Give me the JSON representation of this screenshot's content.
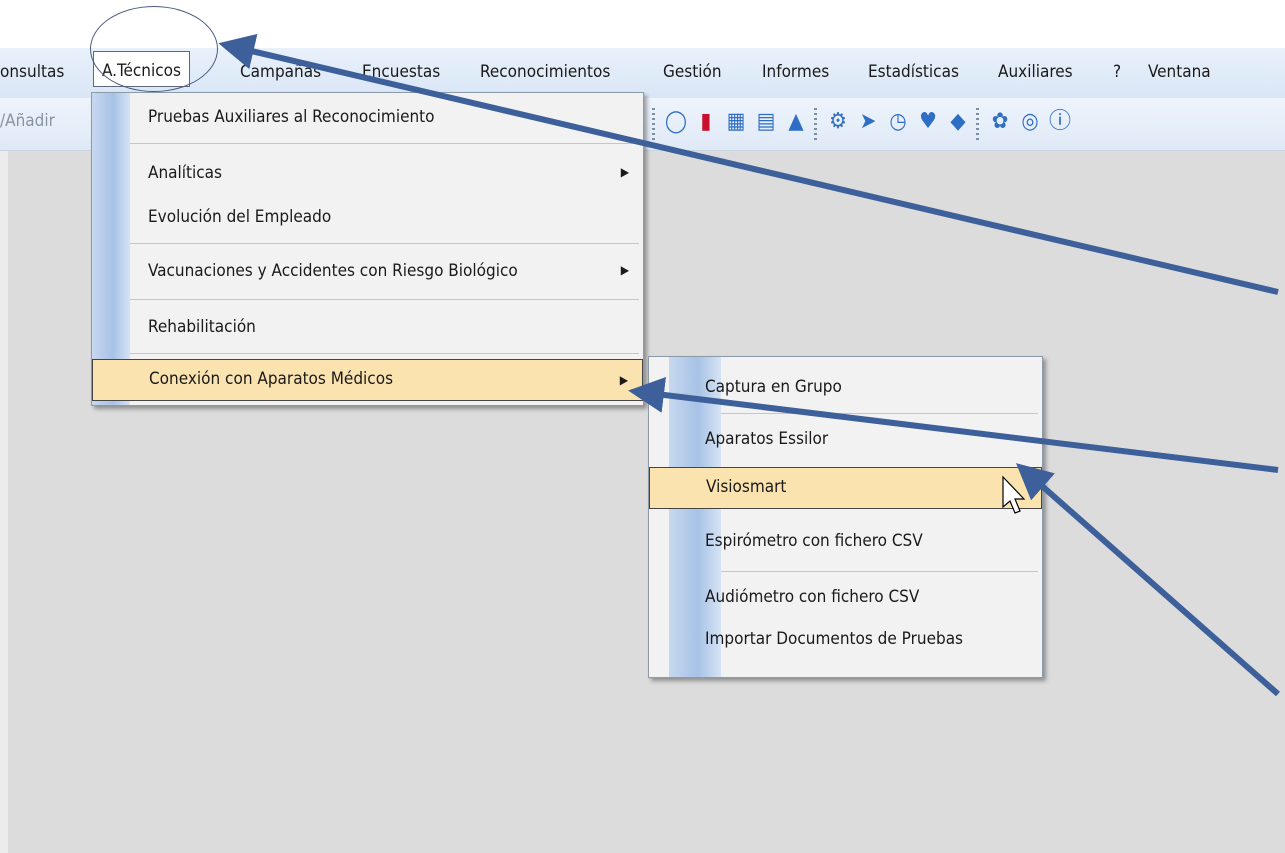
{
  "menubar": {
    "items": [
      "onsultas",
      "A.Técnicos",
      "Campañas",
      "Encuestas",
      "Reconocimientos",
      "Gestión",
      "Informes",
      "Estadísticas",
      "Auxiliares",
      "?",
      "Ventana"
    ]
  },
  "toolbar": {
    "partial_label": "/Añadir",
    "icons": [
      "lightbulb-icon",
      "book-icon",
      "calendar-icon",
      "clipboard-icon",
      "warning-icon",
      "gear-icon",
      "send-icon",
      "clock-icon",
      "heart-icon",
      "tag-icon",
      "lifebuoy-icon",
      "help-ring-icon",
      "info-icon"
    ]
  },
  "menu_atecnicos": {
    "items": [
      {
        "label": "Pruebas Auxiliares al Reconocimiento",
        "submenu": false
      },
      {
        "label": "Analíticas",
        "submenu": true
      },
      {
        "label": "Evolución del Empleado",
        "submenu": false
      },
      {
        "label": "Vacunaciones y Accidentes con Riesgo Biológico",
        "submenu": true
      },
      {
        "label": "Rehabilitación",
        "submenu": false
      },
      {
        "label": "Conexión con Aparatos Médicos",
        "submenu": true,
        "highlighted": true
      }
    ]
  },
  "submenu_conexion": {
    "items": [
      {
        "label": "Captura en Grupo"
      },
      {
        "label": "Aparatos Essilor"
      },
      {
        "label": "Visiosmart",
        "highlighted": true
      },
      {
        "label": "Espirómetro con fichero CSV"
      },
      {
        "label": "Audiómetro con fichero CSV"
      },
      {
        "label": "Importar Documentos de Pruebas"
      }
    ]
  },
  "colors": {
    "menubar": "#dce8f6",
    "highlight": "#fbe3b0",
    "annotation_arrow": "#3d5f9a",
    "workspace": "#dcdcdc"
  }
}
